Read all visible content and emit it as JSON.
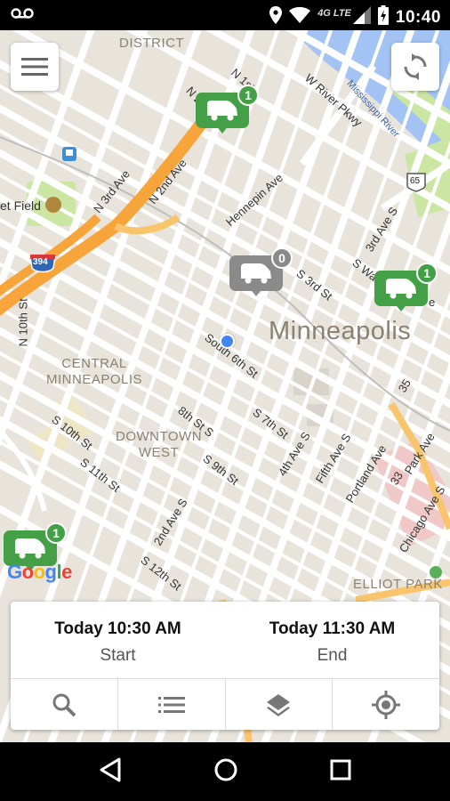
{
  "status_bar": {
    "clock": "10:40",
    "network": "4G LTE",
    "icons": [
      "voicemail-icon",
      "location-icon",
      "wifi-icon",
      "signal-icon",
      "battery-charging-icon"
    ]
  },
  "map": {
    "labels": {
      "district_top": "DISTRICT",
      "n1st": "N 1st",
      "n2": "N 2",
      "w_river": "W River Pkwy",
      "mississippi": "Mississippi River",
      "n3rd": "N 3rd Ave",
      "n2nd": "N 2nd Ave",
      "hennepin": "Hennepin Ave",
      "field": "et Field",
      "shield_394": "394",
      "shield_65": "65",
      "n10th": "N 10th St",
      "s3rd_st": "S 3rd St",
      "s3rd_ave": "3rd Ave S",
      "s_wash": "S Was",
      "e_suffix": "e",
      "city": "Minneapolis",
      "s6th": "South 6th St",
      "central_1": "CENTRAL",
      "central_2": "MINNEAPOLIS",
      "s10th": "S 10th St",
      "s8th": "8th St S",
      "s7th": "S 7th St",
      "downtown_1": "DOWNTOWN",
      "downtown_2": "WEST",
      "ave4": "4th Ave S",
      "fifth": "Fifth Ave S",
      "portland": "Portland Ave",
      "park": "Park Ave",
      "n35": "35",
      "n33": "33",
      "s11th": "S 11th St",
      "s9th": "S 9th St",
      "ave2": "2nd Ave S",
      "s12th": "S 12th St",
      "chicago": "Chicago Ave S",
      "elliot": "ELLIOT PARK"
    },
    "markers": [
      {
        "count": "1"
      },
      {
        "count": "0"
      },
      {
        "count": "1"
      },
      {
        "count": "1"
      }
    ],
    "google": {
      "letters": [
        "G",
        "o",
        "o",
        "g",
        "l",
        "e"
      ]
    }
  },
  "controls": {
    "menu": "menu-icon",
    "refresh": "refresh-icon"
  },
  "reservation": {
    "start_time": "Today 10:30 AM",
    "start_label": "Start",
    "end_time": "Today 11:30 AM",
    "end_label": "End"
  },
  "colors": {
    "green": "#43a047",
    "grey": "#8a8a8a",
    "blue_dot": "#4285f4",
    "highway": "#f7a43a"
  }
}
